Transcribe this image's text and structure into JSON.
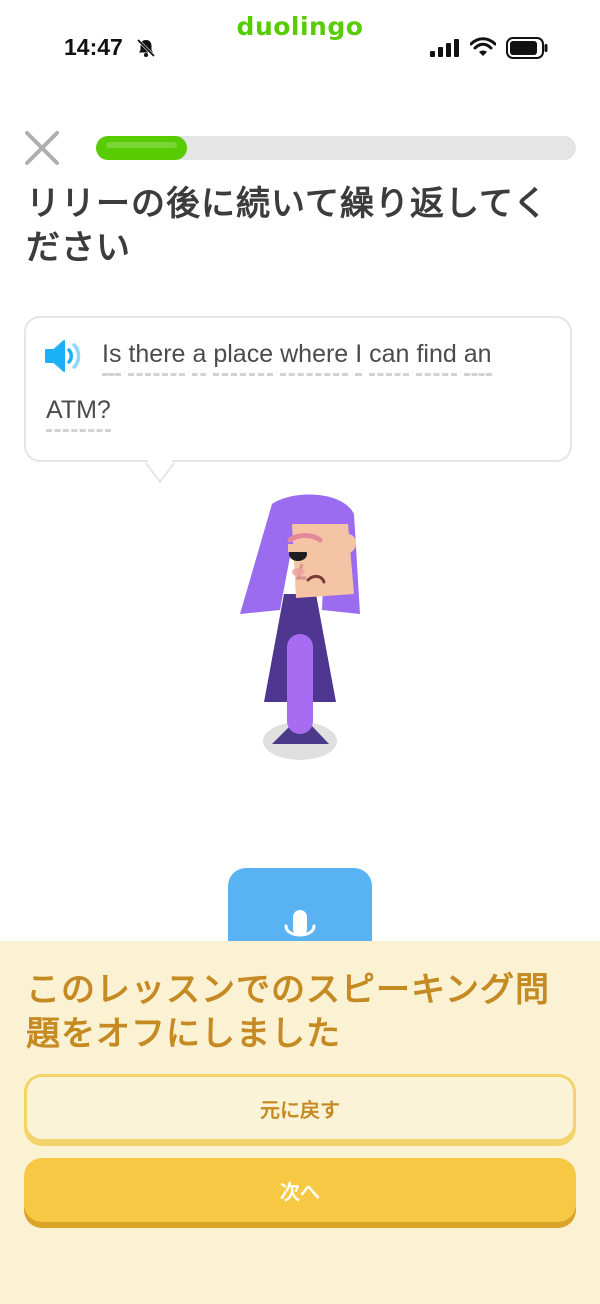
{
  "status_bar": {
    "brand": "duolingo",
    "time": "14:47",
    "icons": [
      "bell-off-icon",
      "cellular-signal-icon",
      "wifi-icon",
      "battery-icon"
    ]
  },
  "lesson": {
    "close_icon": "close-icon",
    "progress": 0.19,
    "title": "リリーの後に続いて繰り返してください",
    "prompt_words_line1": [
      "Is",
      "there",
      "a",
      "place",
      "where",
      "I",
      "can",
      "find",
      "an"
    ],
    "prompt_words_line2": [
      "ATM?"
    ],
    "speaker_icon": "speaker-icon",
    "character": "lily-character",
    "mic_icon": "microphone-icon"
  },
  "feedback_sheet": {
    "message": "このレッスンでのスピーキング問題をオフにしました",
    "undo_label": "元に戻す",
    "next_label": "次へ"
  },
  "colors": {
    "brand_green": "#58cc02",
    "mic_blue": "#59b3f2",
    "sheet_bg": "#fbf2d3",
    "sheet_text": "#c68a23",
    "next_button": "#f7c843"
  }
}
